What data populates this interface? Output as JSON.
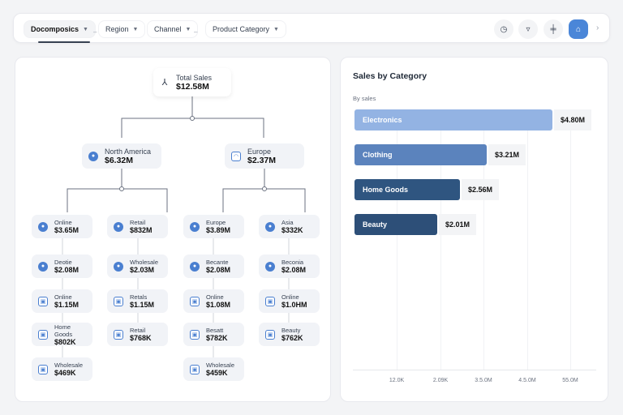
{
  "toolbar": {
    "filters": [
      {
        "label": "Docomposics",
        "active": true
      },
      {
        "label": "Region"
      },
      {
        "label": "Channel"
      },
      {
        "label": "Product Category"
      }
    ],
    "icons": [
      "clock-icon",
      "cup-icon",
      "hierarchy-icon",
      "badge-icon"
    ],
    "more": "›"
  },
  "tree": {
    "root": {
      "label": "Total Sales",
      "value": "$12.58M"
    },
    "level1": [
      {
        "label": "North America",
        "value": "$6.32M"
      },
      {
        "label": "Europe",
        "value": "$2.37M"
      }
    ],
    "columns": [
      [
        {
          "label": "Online",
          "value": "$3.65M"
        },
        {
          "label": "Deotie",
          "value": "$2.08M"
        },
        {
          "label": "Online",
          "value": "$1.15M"
        },
        {
          "label": "Home Goods",
          "value": "$802K"
        },
        {
          "label": "Wholesale",
          "value": "$469K"
        }
      ],
      [
        {
          "label": "Retail",
          "value": "$832M"
        },
        {
          "label": "Wholesale",
          "value": "$2.03M"
        },
        {
          "label": "Retals",
          "value": "$1.15M"
        },
        {
          "label": "Retail",
          "value": "$768K"
        }
      ],
      [
        {
          "label": "Europe",
          "value": "$3.89M"
        },
        {
          "label": "Becante",
          "value": "$2.08M"
        },
        {
          "label": "Online",
          "value": "$1.08M"
        },
        {
          "label": "Besatt",
          "value": "$782K"
        },
        {
          "label": "Wholesale",
          "value": "$459K"
        }
      ],
      [
        {
          "label": "Asia",
          "value": "$332K"
        },
        {
          "label": "Beconia",
          "value": "$2.08M"
        },
        {
          "label": "Online",
          "value": "$1.0HM"
        },
        {
          "label": "Beauty",
          "value": "$762K"
        }
      ]
    ]
  },
  "chart_data": {
    "type": "bar",
    "title": "Sales by Category",
    "subtitle": "By sales",
    "categories": [
      "Electronics",
      "Clothing",
      "Home Goods",
      "Beauty"
    ],
    "values": [
      4.8,
      3.21,
      2.56,
      2.01
    ],
    "labels": [
      "$4.80M",
      "$3.21M",
      "$2.56M",
      "$2.01M"
    ],
    "colors": [
      "#93b3e3",
      "#5b83bd",
      "#2f5580",
      "#2d4f78"
    ],
    "xticks": [
      "12.0K",
      "2.09K",
      "3.5.0M",
      "4.5.0M",
      "55.0M"
    ],
    "grid": true
  }
}
